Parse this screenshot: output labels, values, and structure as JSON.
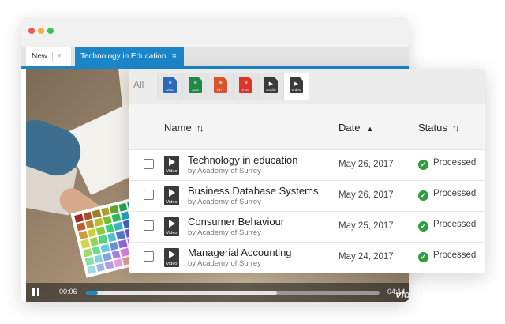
{
  "window": {
    "traffic_lights": [
      "#ec5b5b",
      "#f4b23a",
      "#3fc15a"
    ]
  },
  "tabs": {
    "new_label": "New",
    "active_label": "Technology in Education",
    "close_glyph": "×"
  },
  "player": {
    "current_time": "00:06",
    "end_time": "04:14",
    "played_fraction": 0.04,
    "buffered_fraction": 0.65,
    "watermark": "vid"
  },
  "filters": {
    "all_label": "All",
    "types": [
      {
        "tag": "DOC",
        "color": "#2b6bb5",
        "icon": "doc-file-icon"
      },
      {
        "tag": "XLS",
        "color": "#1f8a45",
        "icon": "xls-file-icon"
      },
      {
        "tag": "PPT",
        "color": "#d9532c",
        "icon": "ppt-file-icon"
      },
      {
        "tag": "PDF",
        "color": "#d9352a",
        "icon": "pdf-file-icon"
      },
      {
        "tag": "Audio",
        "color": "#3a3a3a",
        "icon": "audio-file-icon"
      },
      {
        "tag": "Video",
        "color": "#3a3a3a",
        "icon": "video-file-icon"
      }
    ]
  },
  "table": {
    "headers": {
      "name": "Name",
      "date": "Date",
      "status": "Status"
    },
    "rows": [
      {
        "title": "Technology in education",
        "byline": "by Academy of Surrey",
        "date": "May 26, 2017",
        "status": "Processed",
        "icon_tag": "Video"
      },
      {
        "title": "Business Database Systems",
        "byline": "by Academy of Surrey",
        "date": "May 26, 2017",
        "status": "Processed",
        "icon_tag": "Video"
      },
      {
        "title": "Consumer Behaviour",
        "byline": "by Academy of Surrey",
        "date": "May 25, 2017",
        "status": "Processed",
        "icon_tag": "Video"
      },
      {
        "title": "Managerial Accounting",
        "byline": "by Academy of Surrey",
        "date": "May 24, 2017",
        "status": "Processed",
        "icon_tag": "Video"
      }
    ]
  }
}
